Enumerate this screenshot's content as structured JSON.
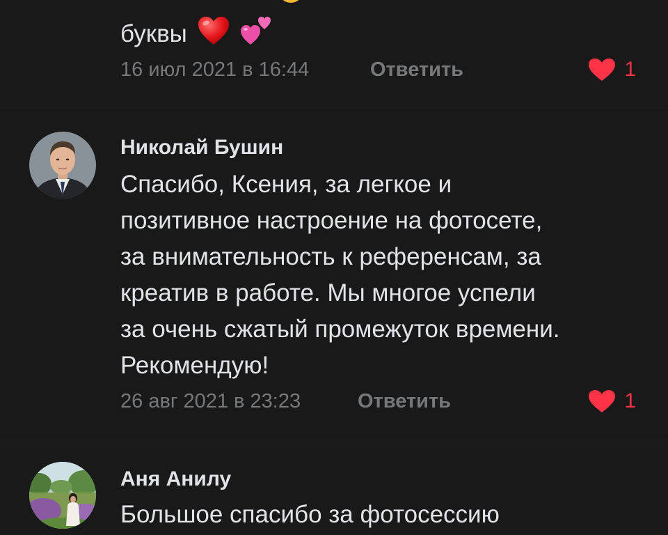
{
  "comments": [
    {
      "text_tail": "буквы",
      "date": "16 июл 2021 в 16:44",
      "reply_label": "Ответить",
      "likes": "1",
      "emojis": [
        "red-heart",
        "two-hearts"
      ]
    },
    {
      "author": "Николай Бушин",
      "lines": [
        "Спасибо, Ксения, за легкое и",
        "позитивное настроение на фотосете,",
        "за внимательность к референсам, за",
        "креатив в работе. Мы многое успели",
        "за очень сжатый промежуток времени.",
        "Рекомендую!"
      ],
      "date": "26 авг 2021 в 23:23",
      "reply_label": "Ответить",
      "likes": "1"
    },
    {
      "author": "Аня Анилу",
      "lines": [
        "Большое спасибо за фотосессию"
      ]
    }
  ],
  "colors": {
    "background": "#19191a",
    "text": "#e1e3e6",
    "secondary": "#76787a",
    "like": "#ff3347"
  }
}
